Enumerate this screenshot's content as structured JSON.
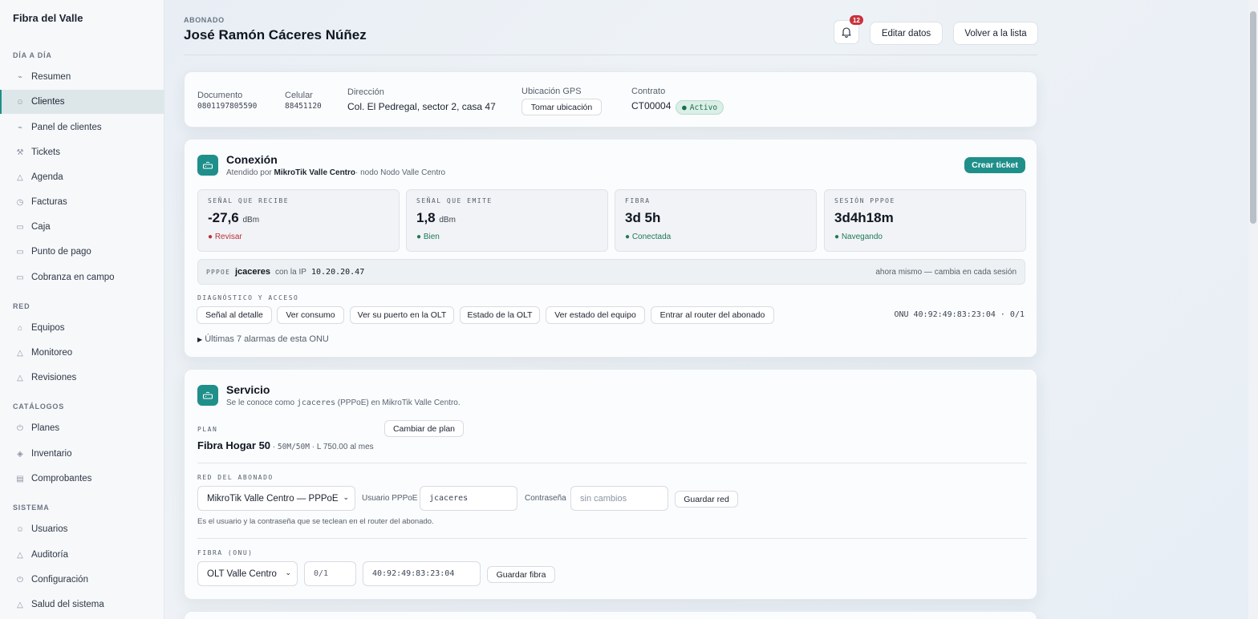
{
  "sidebar": {
    "brand": "Fibra del Valle",
    "sections": [
      {
        "title": "DÍA A DÍA",
        "items": [
          {
            "label": "Resumen",
            "icon": "activity-icon"
          },
          {
            "label": "Clientes",
            "icon": "users-icon",
            "active": true
          },
          {
            "label": "Panel de clientes",
            "icon": "activity-icon"
          },
          {
            "label": "Tickets",
            "icon": "wrench-icon"
          },
          {
            "label": "Agenda",
            "icon": "triangle-icon"
          },
          {
            "label": "Facturas",
            "icon": "clock-icon"
          },
          {
            "label": "Caja",
            "icon": "card-icon"
          },
          {
            "label": "Punto de pago",
            "icon": "card-icon"
          },
          {
            "label": "Cobranza en campo",
            "icon": "card-icon"
          }
        ]
      },
      {
        "title": "RED",
        "items": [
          {
            "label": "Equipos",
            "icon": "router-icon"
          },
          {
            "label": "Monitoreo",
            "icon": "triangle-icon"
          },
          {
            "label": "Revisiones",
            "icon": "triangle-icon"
          }
        ]
      },
      {
        "title": "CATÁLOGOS",
        "items": [
          {
            "label": "Planes",
            "icon": "power-icon"
          },
          {
            "label": "Inventario",
            "icon": "box-icon"
          },
          {
            "label": "Comprobantes",
            "icon": "document-icon"
          }
        ]
      },
      {
        "title": "SISTEMA",
        "items": [
          {
            "label": "Usuarios",
            "icon": "users-icon"
          },
          {
            "label": "Auditoría",
            "icon": "triangle-icon"
          },
          {
            "label": "Configuración",
            "icon": "power-icon"
          },
          {
            "label": "Salud del sistema",
            "icon": "triangle-icon"
          }
        ]
      }
    ]
  },
  "header": {
    "eyebrow": "ABONADO",
    "title": "José Ramón Cáceres Núñez",
    "notifications": "12",
    "edit_label": "Editar datos",
    "back_label": "Volver a la lista"
  },
  "client_info": {
    "document_label": "Documento",
    "document": "0801197805590",
    "phone_label": "Celular",
    "phone": "88451120",
    "address_label": "Dirección",
    "address": "Col. El Pedregal, sector 2, casa 47",
    "gps_label": "Ubicación GPS",
    "gps_button": "Tomar ubicación",
    "contract_label": "Contrato",
    "contract": "CT00004",
    "contract_status": "Activo"
  },
  "connection": {
    "title": "Conexión",
    "subtitle_prefix": "Atendido por",
    "router": "MikroTik Valle Centro",
    "subtitle_suffix": "· nodo Nodo Valle Centro",
    "ticket_button": "Crear ticket",
    "metrics": [
      {
        "label": "SEÑAL QUE RECIBE",
        "value": "-27,6",
        "unit": "dBm",
        "status": "Revisar",
        "status_color": "#b8323a"
      },
      {
        "label": "SEÑAL QUE EMITE",
        "value": "1,8",
        "unit": "dBm",
        "status": "Bien",
        "status_color": "#1f7a54"
      },
      {
        "label": "FIBRA",
        "value": "3d 5h",
        "unit": "",
        "status": "Conectada",
        "status_color": "#1f7a54"
      },
      {
        "label": "SESIÓN PPPOE",
        "value": "3d4h18m",
        "unit": "",
        "status": "Navegando",
        "status_color": "#1f7a54"
      }
    ],
    "pppoe_tag": "PPPOE",
    "pppoe_user": "jcaceres",
    "ip_label": "con la IP",
    "ip": "10.20.20.47",
    "ip_note": "ahora mismo — cambia en cada sesión",
    "diag_title": "DIAGNÓSTICO Y ACCESO",
    "actions": [
      "Señal al detalle",
      "Ver consumo",
      "Ver su puerto en la OLT",
      "Estado de la OLT",
      "Ver estado del equipo",
      "Entrar al router del abonado"
    ],
    "onu_info": "ONU 40:92:49:83:23:04 · 0/1",
    "alarms_toggle": "Últimas 7 alarmas de esta ONU"
  },
  "service": {
    "title": "Servicio",
    "subtitle_prefix": "Se le conoce como",
    "user": "jcaceres",
    "subtitle_suffix": "(PPPoE) en MikroTik Valle Centro.",
    "plan_caption": "PLAN",
    "change_plan": "Cambiar de plan",
    "plan_name": "Fibra Hogar 50",
    "plan_speed": "50M/50M",
    "plan_price": "L 750.00 al mes",
    "net_caption": "RED DEL ABONADO",
    "router_select": "MikroTik Valle Centro — PPPoE",
    "user_label": "Usuario PPPoE",
    "user_value": "jcaceres",
    "password_label": "Contraseña",
    "password_placeholder": "sin cambios",
    "save_net": "Guardar red",
    "net_hint": "Es el usuario y la contraseña que se teclean en el router del abonado.",
    "fiber_caption": "FIBRA (ONU)",
    "olt_select": "OLT Valle Centro",
    "port_value": "0/1",
    "mac_value": "40:92:49:83:23:04",
    "save_fiber": "Guardar fibra"
  },
  "colors": {
    "accent": "#1f8f8a",
    "danger": "#b8323a",
    "success": "#1f7a54"
  }
}
